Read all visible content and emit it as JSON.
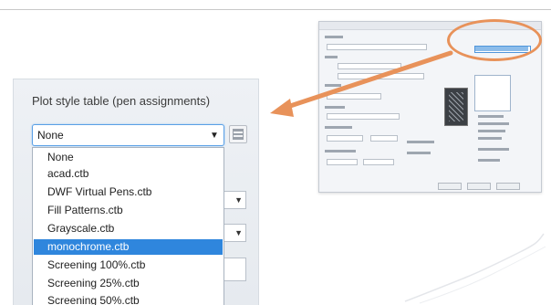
{
  "plot_style_panel": {
    "title": "Plot style table (pen assignments)",
    "selected_value": "None",
    "options": [
      "None",
      "acad.ctb",
      "DWF Virtual Pens.ctb",
      "Fill Patterns.ctb",
      "Grayscale.ctb",
      "monochrome.ctb",
      "Screening 100%.ctb",
      "Screening 25%.ctb",
      "Screening 50%.ctb"
    ],
    "highlighted_option": "monochrome.ctb"
  },
  "colors": {
    "highlight": "#2f86dd",
    "focus_border": "#5aa0e6",
    "callout_arrow": "#e8925a",
    "panel_bg": "#eef1f5"
  },
  "icons": {
    "dropdown_arrow": "chevron-down-icon",
    "edit_button": "edit-table-icon",
    "callout": "callout-arrow-icon"
  }
}
